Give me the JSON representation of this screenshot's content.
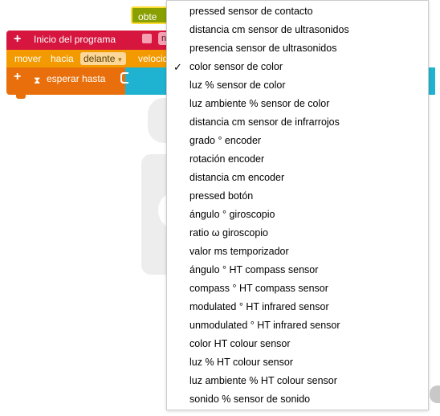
{
  "blocks": {
    "start_label": "Inicio del programa",
    "start_pill_text": "n",
    "move_label": "mover",
    "move_towards": "hacia",
    "move_direction": "delante",
    "move_speed": "velocid",
    "wait_label": "esperar hasta",
    "sensor_value": "obte"
  },
  "dropdown": {
    "selected_index": 3,
    "options": [
      "pressed sensor de contacto",
      "distancia cm sensor de ultrasonidos",
      "presencia sensor de ultrasonidos",
      "color sensor de color",
      "luz % sensor de color",
      "luz ambiente % sensor de color",
      "distancia cm sensor de infrarrojos",
      "grado ° encoder",
      "rotación encoder",
      "distancia cm encoder",
      "pressed botón",
      "ángulo ° giroscopio",
      "ratio ω giroscopio",
      "valor ms temporizador",
      "ángulo ° HT compass sensor",
      "compass ° HT compass sensor",
      "modulated ° HT infrared sensor",
      "unmodulated ° HT infrared sensor",
      "color HT colour sensor",
      "luz % HT colour sensor",
      "luz ambiente % HT colour sensor",
      "sonido % sensor de sonido"
    ]
  },
  "colors": {
    "start_block": "#d6163f",
    "move_block": "#f29a00",
    "wait_block": "#e86f0b",
    "sensor_block": "#1fb3d1",
    "sensor_value_block": "#8aa000"
  },
  "icons": {
    "add": "plus-icon",
    "wait": "hourglass-icon",
    "dropdown": "chevron-down-icon",
    "selected": "checkmark-icon"
  }
}
